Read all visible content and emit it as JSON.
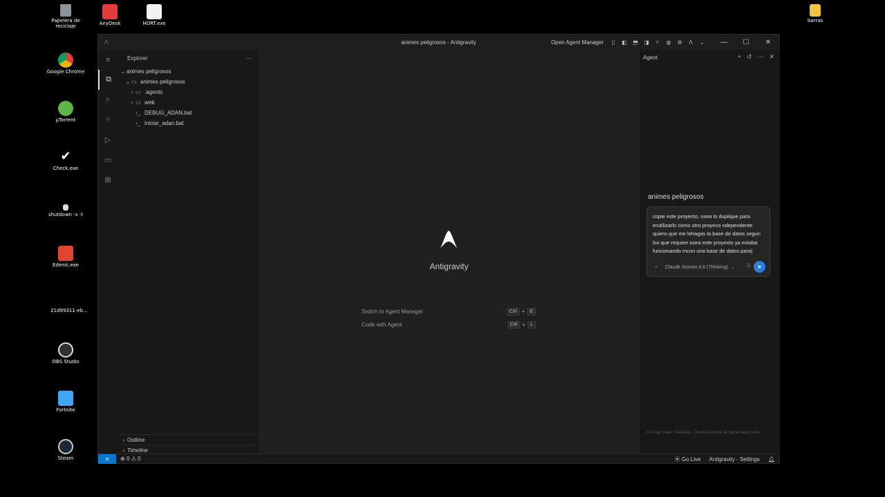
{
  "desktop": {
    "icons_left": [
      {
        "label": "Papelera de reciclaje",
        "name": "recycle-bin-icon",
        "color": "#9aa3ad"
      },
      {
        "label": "AnyDesk",
        "name": "anydesk-icon",
        "color": "#e23c3c"
      },
      {
        "label": "HORT.exe",
        "name": "hort-exe-icon",
        "color": "#f2f2f2"
      },
      {
        "label": "Google Chrome",
        "name": "chrome-icon",
        "color": "#db4437"
      },
      {
        "label": "µTorrent",
        "name": "utorrent-icon",
        "color": "#5fb546"
      },
      {
        "label": "Check.exe",
        "name": "check-exe-icon",
        "color": "#ffffff"
      },
      {
        "label": "shutdown -s -t",
        "name": "shutdown-icon",
        "color": "#dddddd"
      },
      {
        "label": "Edenic.exe",
        "name": "edenic-exe-icon",
        "color": "#e2452e"
      },
      {
        "label": "21d99311-eb...",
        "name": "file-icon",
        "color": "#000000"
      },
      {
        "label": "OBS Studio",
        "name": "obs-studio-icon",
        "color": "#303030"
      },
      {
        "label": "Fortnite",
        "name": "fortnite-icon",
        "color": "#3fa6f5"
      },
      {
        "label": "Steam",
        "name": "steam-icon",
        "color": "#1b2838"
      }
    ],
    "icon_barras": {
      "label": "barras",
      "name": "folder-barras-icon",
      "color": "#f4c542"
    }
  },
  "window": {
    "title": "animes peligrosos - Antigravity",
    "open_agent_manager": "Open Agent Manager"
  },
  "explorer": {
    "header": "Explorer",
    "more": "···",
    "root": "animes peligrosos",
    "folder": "animes peligrosos",
    "items": [
      {
        "label": ".agents",
        "type": "folder"
      },
      {
        "label": "web",
        "type": "folder"
      },
      {
        "label": "DEBUG_ADAN.bat",
        "type": "file"
      },
      {
        "label": "iniciar_adan.bat",
        "type": "file"
      }
    ],
    "outline": "Outline",
    "timeline": "Timeline"
  },
  "editor": {
    "brand": "Antigravity",
    "shortcuts": [
      {
        "label": "Switch to Agent Manager",
        "mod": "Ctrl",
        "plus": "+",
        "key": "E"
      },
      {
        "label": "Code with Agent",
        "mod": "Ctrl",
        "plus": "+",
        "key": "L"
      }
    ]
  },
  "agent": {
    "header": "Agent",
    "workspace": "animes peligrosos",
    "input_text": "copie este proyecto, osea lo duplique para erutilizarlo como otro proyeco ndependente quiero que me lehagas la base de datos segun los que requiee osea este proyexto ya estaba funcionando mcon una base de datos para|",
    "model": "Claude Sonnet 4.6 (Thinking)",
    "disclaimer": "AI may make mistakes. Double-check all generated code."
  },
  "statusbar": {
    "errors": "0",
    "warnings": "0",
    "go_live": "Go Live",
    "settings": "Antigravity - Settings"
  },
  "colors": {
    "accent": "#0078d4",
    "send_button": "#2d7be0"
  }
}
